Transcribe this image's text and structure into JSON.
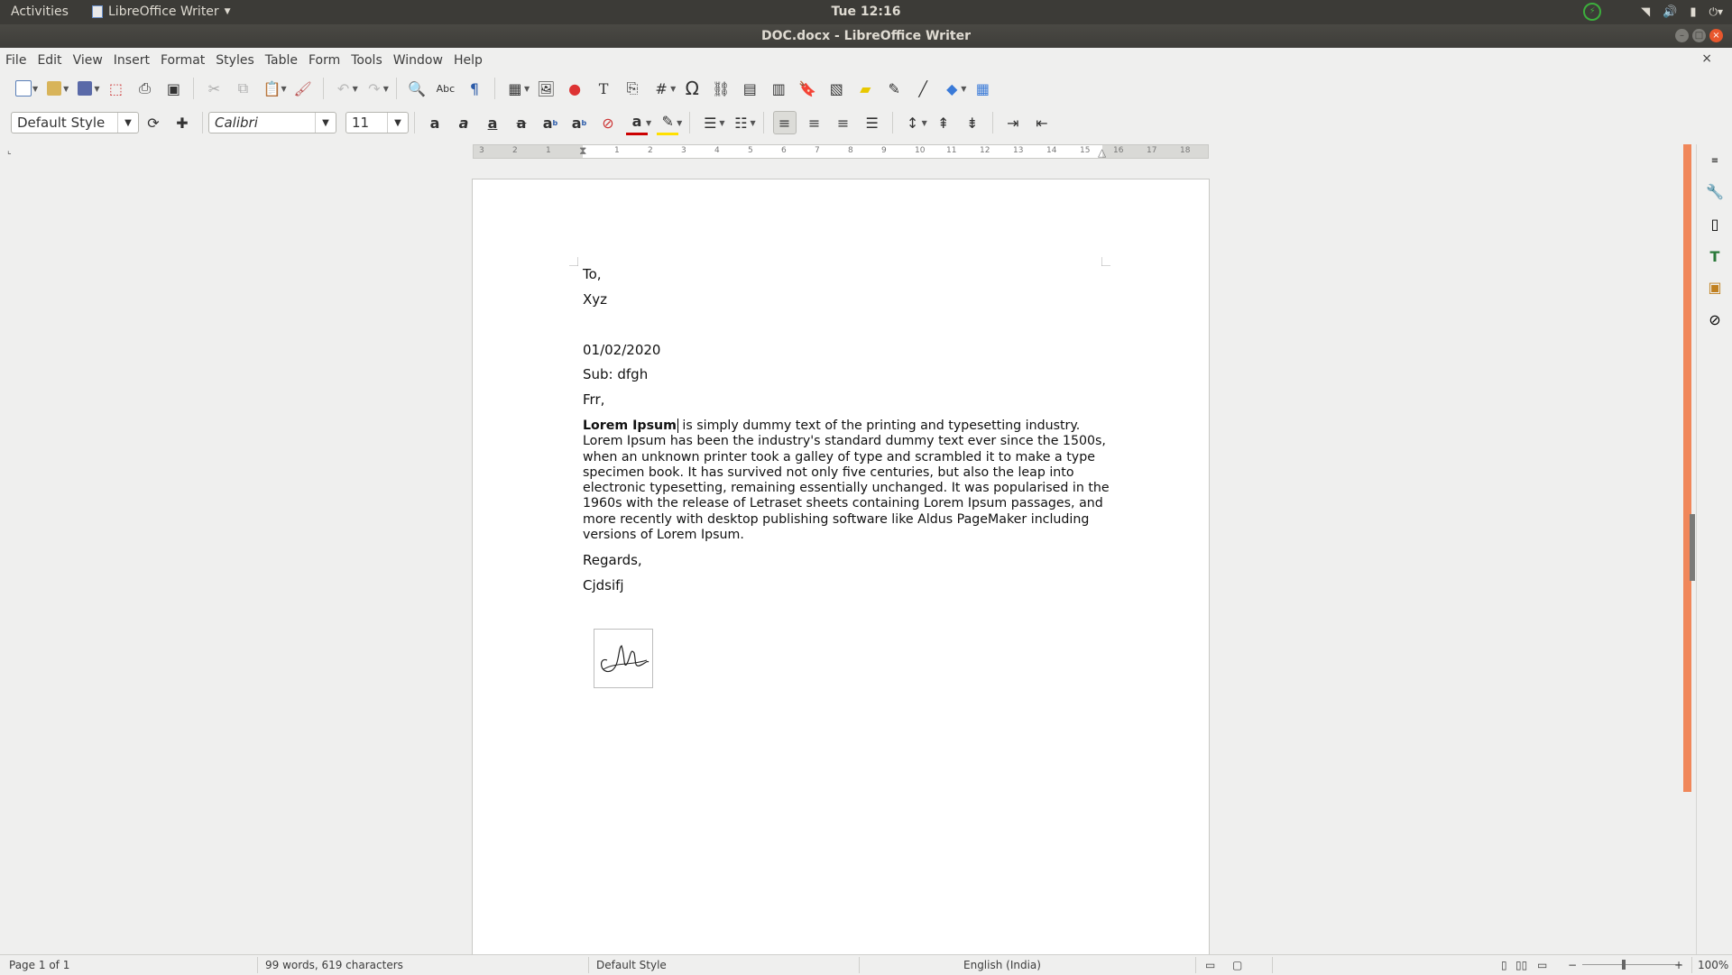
{
  "system_bar": {
    "activities": "Activities",
    "app_name": "LibreOffice Writer",
    "clock": "Tue 12:16"
  },
  "window": {
    "title": "DOC.docx - LibreOffice Writer"
  },
  "menu": [
    "File",
    "Edit",
    "View",
    "Insert",
    "Format",
    "Styles",
    "Table",
    "Form",
    "Tools",
    "Window",
    "Help"
  ],
  "formatting": {
    "paragraph_style": "Default Style",
    "font_name": "Calibri",
    "font_size": "11"
  },
  "ruler": {
    "labels": [
      "3",
      "2",
      "1",
      "1",
      "2",
      "3",
      "4",
      "5",
      "6",
      "7",
      "8",
      "9",
      "10",
      "11",
      "12",
      "13",
      "14",
      "15",
      "16",
      "17",
      "18"
    ]
  },
  "document": {
    "lines": [
      "To,",
      "Xyz",
      "01/02/2020",
      "Sub: dfgh",
      "Frr,"
    ],
    "body_bold": "Lorem Ipsum",
    "body_text": " is simply dummy text of the printing and typesetting industry. Lorem Ipsum has been the industry's standard dummy text ever since the 1500s, when an unknown printer took a galley of type and scrambled it to make a type specimen book. It has survived not only five centuries, but also the leap into electronic typesetting, remaining essentially unchanged. It was popularised in the 1960s with the release of Letraset sheets containing Lorem Ipsum passages, and more recently with desktop publishing software like Aldus PageMaker including versions of Lorem Ipsum.",
    "closing": "Regards,",
    "signer": "Cjdsifj"
  },
  "status": {
    "page": "Page 1 of 1",
    "words": "99 words, 619 characters",
    "style": "Default Style",
    "language": "English (India)",
    "zoom": "100%"
  },
  "colors": {
    "accent_scroll": "#f0875a",
    "close_button": "#e8572d",
    "titlebar": "#3c3b37"
  }
}
